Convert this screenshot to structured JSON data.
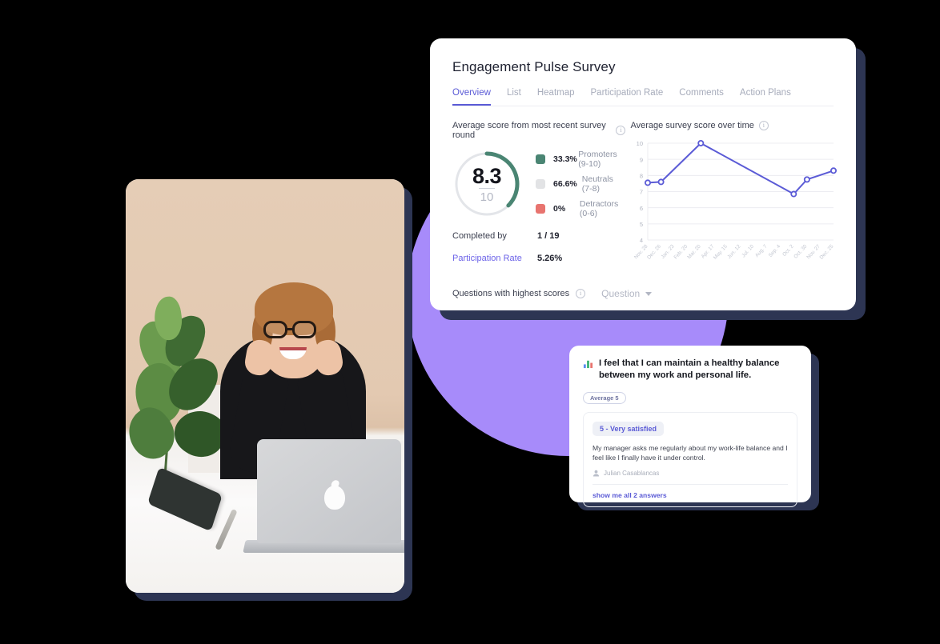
{
  "dashboard": {
    "title": "Engagement Pulse Survey",
    "tabs": [
      {
        "label": "Overview",
        "active": true
      },
      {
        "label": "List",
        "active": false
      },
      {
        "label": "Heatmap",
        "active": false
      },
      {
        "label": "Participation Rate",
        "active": false
      },
      {
        "label": "Comments",
        "active": false
      },
      {
        "label": "Action Plans",
        "active": false
      }
    ],
    "score_panel": {
      "heading": "Average score from most recent survey round",
      "score": "8.3",
      "max": "10",
      "arc_color": "#4a8573",
      "legend": [
        {
          "pct": "33.3%",
          "label": "Promoters (9-10)",
          "color": "#4a8573"
        },
        {
          "pct": "66.6%",
          "label": "Neutrals (7-8)",
          "color": "#e2e3e5"
        },
        {
          "pct": "0%",
          "label": "Detractors (0-6)",
          "color": "#e8746f"
        }
      ],
      "stats": [
        {
          "key": "Completed by",
          "value": "1 / 19",
          "link": false
        },
        {
          "key": "Participation Rate",
          "value": "5.26%",
          "link": true
        }
      ]
    },
    "chart_panel": {
      "heading": "Average survey score over time"
    },
    "footer": {
      "label": "Questions with highest scores",
      "dropdown_value": "Question"
    }
  },
  "chart_data": {
    "type": "line",
    "title": "Average survey score over time",
    "xlabel": "",
    "ylabel": "",
    "ylim": [
      4,
      10
    ],
    "yticks": [
      4,
      5,
      6,
      7,
      8,
      9,
      10
    ],
    "grid": true,
    "legend_position": "none",
    "line_color": "#5b5bd6",
    "categories": [
      "Nov. 28",
      "Dec. 26",
      "Jan. 23",
      "Feb. 20",
      "Mar. 20",
      "Apr. 17",
      "May. 15",
      "Jun. 12",
      "Jul. 10",
      "Aug. 7",
      "Sep. 4",
      "Oct. 2",
      "Oct. 30",
      "Nov. 27",
      "Dec. 25"
    ],
    "values": [
      7.55,
      7.6,
      null,
      null,
      10.0,
      null,
      null,
      null,
      null,
      null,
      null,
      6.85,
      7.75,
      null,
      8.3
    ]
  },
  "comment": {
    "question": "I feel that I can maintain a healthy balance between my work and personal life.",
    "average_badge": "Average 5",
    "answer_chip": "5 - Very satisfied",
    "answer_text": "My manager asks me regularly about my work-life balance and I feel like I finally have it under control.",
    "author": "Julian Casablancas",
    "show_all": "show me all 2 answers"
  },
  "photo": {
    "alt": "Smiling woman with glasses at a desk with a laptop"
  }
}
